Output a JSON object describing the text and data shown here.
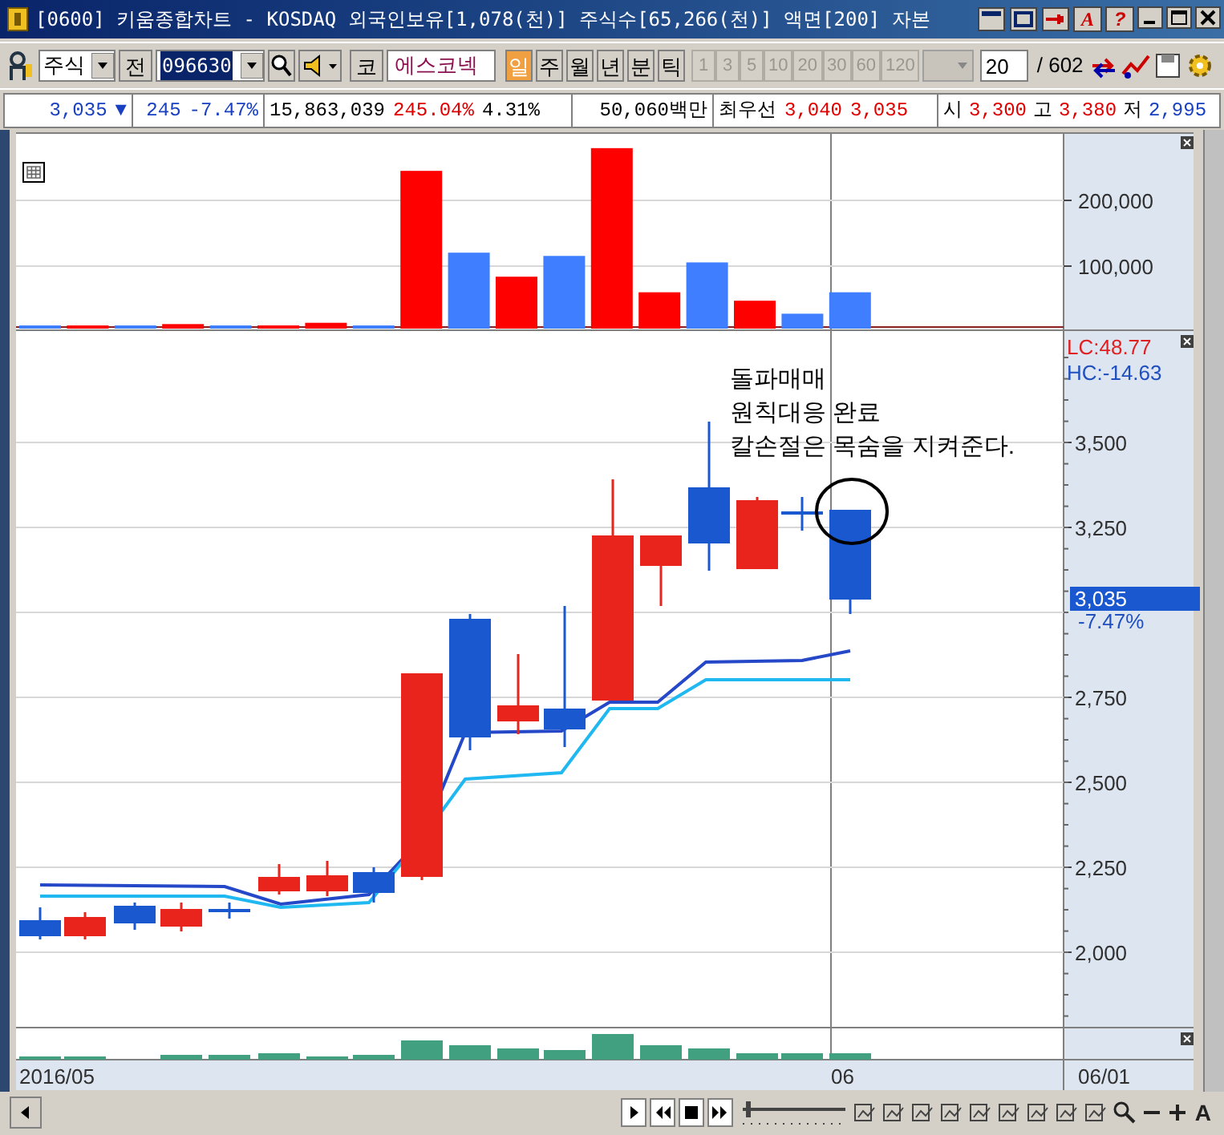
{
  "window": {
    "title": "[0600] 키움종합차트 - KOSDAQ 외국인보유[1,078(천)] 주식수[65,266(천)] 액면[200] 자본",
    "tool_buttons": [
      "A",
      "?"
    ]
  },
  "toolbar": {
    "market": "주식",
    "prev_button": "전",
    "code": "096630",
    "code_button": "코",
    "stock_name": "에스코넥",
    "periods": [
      {
        "label": "일",
        "selected": true
      },
      {
        "label": "주",
        "selected": false
      },
      {
        "label": "월",
        "selected": false
      },
      {
        "label": "년",
        "selected": false
      },
      {
        "label": "분",
        "selected": false
      },
      {
        "label": "틱",
        "selected": false
      }
    ],
    "intervals": [
      {
        "label": "1",
        "disabled": true
      },
      {
        "label": "3",
        "disabled": true
      },
      {
        "label": "5",
        "disabled": true
      },
      {
        "label": "10",
        "disabled": true
      },
      {
        "label": "20",
        "disabled": true
      },
      {
        "label": "30",
        "disabled": true
      },
      {
        "label": "60",
        "disabled": true
      },
      {
        "label": "120",
        "disabled": true
      }
    ],
    "count": "20",
    "total": "/ 602"
  },
  "info_bar": {
    "price": "3,035",
    "arrow": "▼",
    "change": "245",
    "change_rate": "-7.47%",
    "volume": "15,863,039",
    "volume_ratio": "245.04%",
    "turnover": "4.31%",
    "amount": "50,060백만",
    "best_label": "최우선",
    "ask": "3,040",
    "bid": "3,035",
    "open_label": "시",
    "open": "3,300",
    "high_label": "고",
    "high": "3,380",
    "low_label": "저",
    "low": "2,995"
  },
  "volume_panel": {
    "y_labels": [
      "200,000",
      "100,000"
    ]
  },
  "price_panel": {
    "lc": "LC:48.77",
    "hc": "HC:-14.63",
    "y_labels": [
      "3,500",
      "3,250",
      "2,750",
      "2,500",
      "2,250",
      "2,000"
    ],
    "current_price": "3,035",
    "current_change": "-7.47%",
    "annotation": [
      "돌파매매",
      "원칙대응 완료",
      "칼손절은 목숨을 지켜준다."
    ]
  },
  "date_axis": [
    "2016/05",
    "06",
    "06/01"
  ],
  "bottom_bar": {
    "font_button": "A"
  }
}
